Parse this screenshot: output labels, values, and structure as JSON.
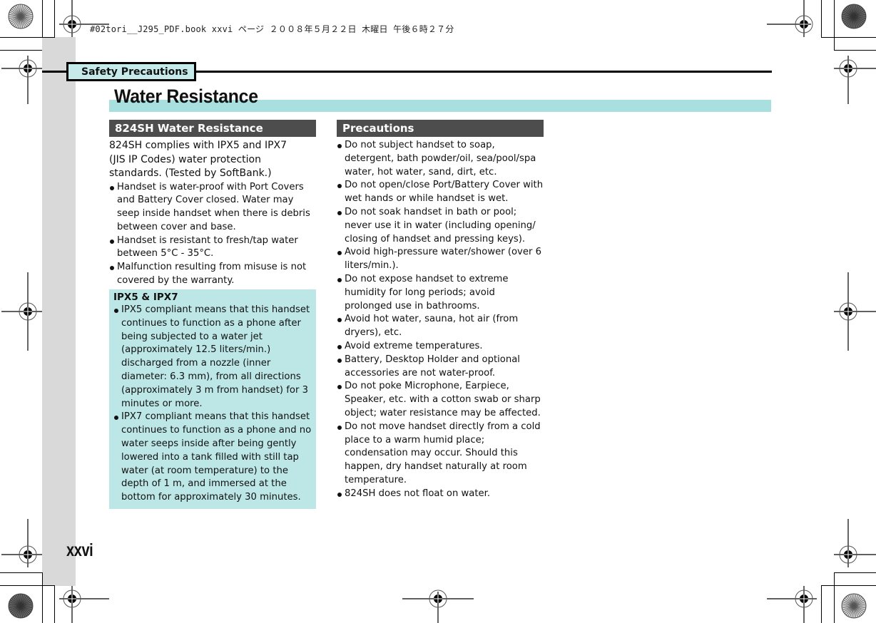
{
  "header_info": "#02tori__J295_PDF.book  xxvi ページ  ２００８年５月２２日  木曜日  午後６時２７分",
  "section_tab": "Safety Precautions",
  "page_title": "Water Resistance",
  "page_number": "xxvi",
  "left_column": {
    "heading": "824SH Water Resistance",
    "intro": "824SH complies with IPX5 and IPX7 (JIS IP Codes) water protection standards. (Tested by SoftBank.)",
    "bullets": [
      "Handset is water-proof with Port Covers and Battery Cover closed. Water may seep inside handset when there is debris between cover and base.",
      "Handset is resistant to fresh/tap water between 5°C - 35°C.",
      "Malfunction resulting from misuse is not covered by the warranty."
    ],
    "note_box": {
      "title": "IPX5 & IPX7",
      "bullets": [
        "IPX5 compliant means that this handset continues to function as a phone after being subjected to a water jet (approximately 12.5 liters/min.) discharged from a nozzle (inner diameter: 6.3 mm), from all directions (approximately 3 m from handset) for 3 minutes or more.",
        "IPX7 compliant means that this handset continues to function as a phone and no water seeps inside after being gently lowered into a tank filled with still tap water (at room temperature) to the depth of 1 m, and immersed at the bottom for approximately 30 minutes."
      ]
    }
  },
  "right_column": {
    "heading": "Precautions",
    "bullets": [
      "Do not subject handset to soap, detergent, bath powder/oil, sea/pool/spa water, hot water, sand, dirt, etc.",
      "Do not open/close Port/Battery Cover with wet hands or while handset is wet.",
      "Do not soak handset in bath or pool; never use it in water (including opening/ closing of handset and pressing keys).",
      "Avoid high-pressure water/shower (over 6 liters/min.).",
      "Do not expose handset to extreme humidity for long periods; avoid prolonged use in bathrooms.",
      "Avoid hot water, sauna, hot air (from dryers), etc.",
      "Avoid extreme temperatures.",
      "Battery, Desktop Holder and optional accessories are not water-proof.",
      "Do not poke Microphone, Earpiece, Speaker, etc. with a cotton swab or sharp object; water resistance may be affected.",
      "Do not move handset directly from a cold place to a warm humid place; condensation may occur. Should this happen, dry handset naturally at room temperature.",
      "824SH does not float on water."
    ]
  },
  "colors": {
    "tab_fill": "#c6eaea",
    "title_band": "#a8dfdf",
    "note_box": "#bde7e7",
    "heading_bar": "#4d4d4d",
    "side_strip": "#d9d9d9"
  }
}
